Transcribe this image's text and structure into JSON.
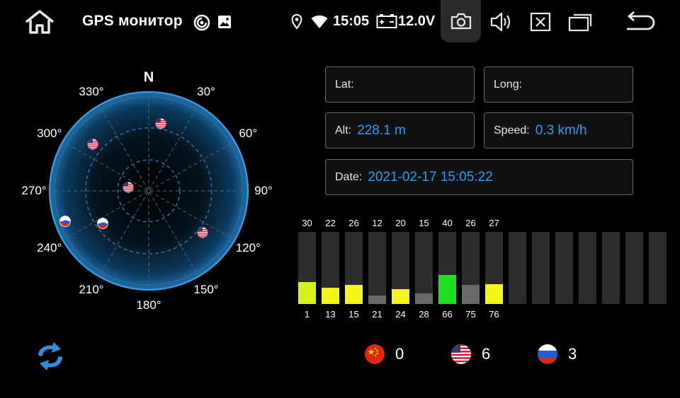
{
  "header": {
    "app_title": "GPS монитор",
    "clock": "15:05",
    "voltage": "12.0V",
    "icons": [
      "home-icon",
      "screen-cast-icon",
      "image-icon",
      "location-pin-icon",
      "wifi-icon",
      "battery-icon",
      "camera-icon",
      "volume-icon",
      "close-window-icon",
      "recent-apps-icon",
      "back-arrow-icon"
    ],
    "camera_bg": "#2a2a2a"
  },
  "skyplot": {
    "north_label": "N",
    "azimuth_labels": [
      {
        "angle": 30,
        "text": "30°"
      },
      {
        "angle": 60,
        "text": "60°"
      },
      {
        "angle": 90,
        "text": "90°"
      },
      {
        "angle": 120,
        "text": "120°"
      },
      {
        "angle": 150,
        "text": "150°"
      },
      {
        "angle": 180,
        "text": "180°"
      },
      {
        "angle": 210,
        "text": "210°"
      },
      {
        "angle": 240,
        "text": "240°"
      },
      {
        "angle": 270,
        "text": "270°"
      },
      {
        "angle": 300,
        "text": "300°"
      },
      {
        "angle": 330,
        "text": "330°"
      }
    ],
    "satellites": [
      {
        "system": "gps",
        "azimuth": 10,
        "elevation": 25
      },
      {
        "system": "gps",
        "azimuth": 310,
        "elevation": 20
      },
      {
        "system": "gps",
        "azimuth": 280,
        "elevation": 70
      },
      {
        "system": "glonass",
        "azimuth": 250,
        "elevation": 5
      },
      {
        "system": "glonass",
        "azimuth": 235,
        "elevation": 36
      },
      {
        "system": "gps",
        "azimuth": 128,
        "elevation": 25
      }
    ]
  },
  "info": {
    "lat_label": "Lat:",
    "lat_value": "",
    "long_label": "Long:",
    "long_value": "",
    "alt_label": "Alt:",
    "alt_value": "228.1 m",
    "speed_label": "Speed:",
    "speed_value": "0.3 km/h",
    "date_label": "Date:",
    "date_value": "2021-02-17  15:05:22",
    "value_color": "#2e9cf5"
  },
  "signal": {
    "slot_count": 16,
    "max_snr": 99,
    "satellites": [
      {
        "prn": "1",
        "snr": "30",
        "color": "#d8f01c"
      },
      {
        "prn": "13",
        "snr": "22",
        "color": "#f5f51e"
      },
      {
        "prn": "15",
        "snr": "26",
        "color": "#f5f51e"
      },
      {
        "prn": "21",
        "snr": "12",
        "color": "#6a6a6a"
      },
      {
        "prn": "24",
        "snr": "20",
        "color": "#f5f51e"
      },
      {
        "prn": "28",
        "snr": "15",
        "color": "#6a6a6a"
      },
      {
        "prn": "66",
        "snr": "40",
        "color": "#1ee01e"
      },
      {
        "prn": "75",
        "snr": "26",
        "color": "#6a6a6a"
      },
      {
        "prn": "76",
        "snr": "27",
        "color": "#f5f51e"
      }
    ]
  },
  "constellations": {
    "beidou_count": "0",
    "gps_count": "6",
    "glonass_count": "3"
  }
}
